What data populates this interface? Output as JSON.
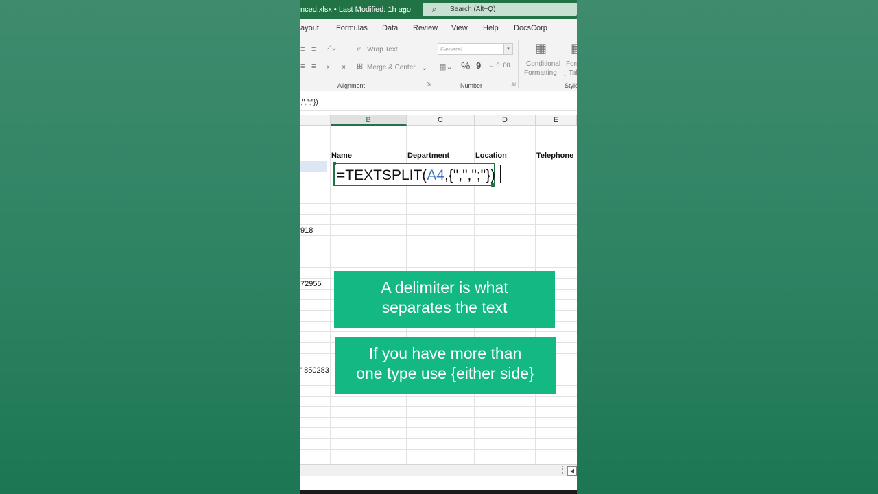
{
  "titlebar": {
    "file_label": "nced.xlsx • Last Modified: 1h ago",
    "search_placeholder": "Search (Alt+Q)"
  },
  "menu_tabs": [
    "ayout",
    "Formulas",
    "Data",
    "Review",
    "View",
    "Help",
    "DocsCorp"
  ],
  "ribbon": {
    "wrap_text": "Wrap Text",
    "merge_center": "Merge & Center",
    "number_format": "General",
    "conditional_formatting_1": "Conditional",
    "conditional_formatting_2": "Formatting",
    "format_table_1": "Forn",
    "format_table_2": "Tal",
    "groups": {
      "alignment": "Alignment",
      "number": "Number",
      "styles": "Style"
    },
    "percent_symbol": "%",
    "comma_symbol": "9"
  },
  "formula_bar": {
    "text": ",\",\";\"})"
  },
  "columns": [
    "B",
    "C",
    "D",
    "E"
  ],
  "headers": {
    "name": "Name",
    "department": "Department",
    "location": "Location",
    "telephone": "Telephone"
  },
  "edit_cell": {
    "prefix": "=TEXTSPLIT(",
    "ref": "A4",
    "suffix": ",{\",\",\";\"})"
  },
  "cells_col_a": [
    "918",
    "72955",
    "' 850283"
  ],
  "callouts": {
    "first_line1": "A delimiter is what",
    "first_line2": "separates the text",
    "second_line1": "If you have more than",
    "second_line2": "one type use {either side}"
  },
  "colors": {
    "excel_green": "#217346",
    "callout_green": "#14b883",
    "ref_blue": "#4472c4"
  }
}
